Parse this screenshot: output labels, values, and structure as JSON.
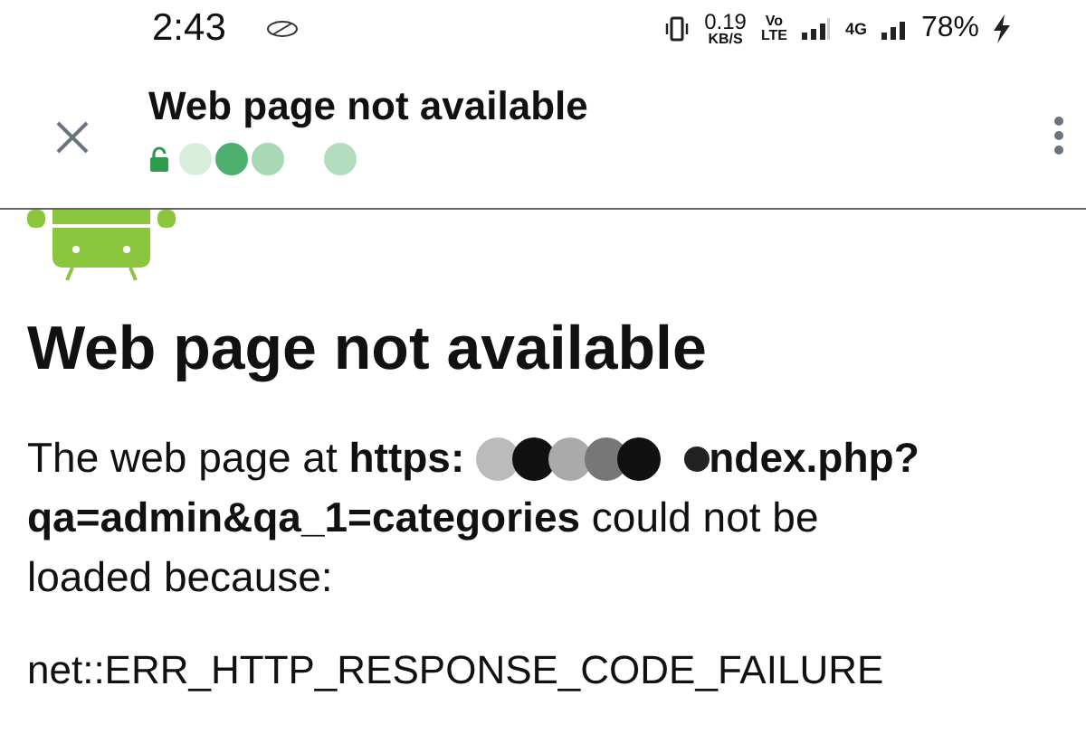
{
  "status_bar": {
    "time": "2:43",
    "speed": "0.19",
    "speed_unit": "KB/S",
    "volte_top": "Vo",
    "volte_bottom": "LTE",
    "network": "4G",
    "battery": "78%",
    "charging": true
  },
  "toolbar": {
    "title": "Web page not available",
    "secure": false
  },
  "page": {
    "heading": "Web page not available",
    "text_before": "The web page at **https:**",
    "url_end": "ndex.php?",
    "text_after": "**qa=admin&qa_1=categories** could not be loaded because:",
    "error": "net::ERR_HTTP_RESPONSE_CODE_FAILURE"
  }
}
